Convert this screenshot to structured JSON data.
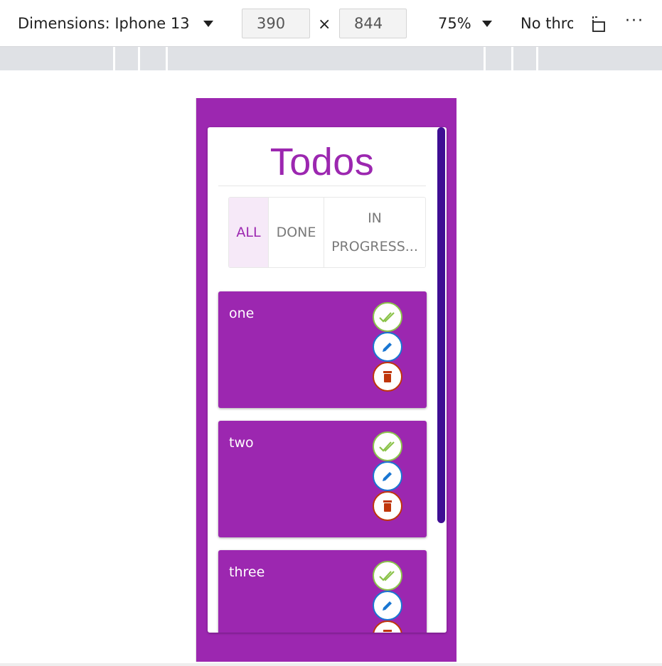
{
  "devtools": {
    "dimensions_label": "Dimensions: Iphone 13",
    "width_value": "390",
    "height_value": "844",
    "times_sign": "×",
    "zoom_label": "75%",
    "throttle_label": "No thro",
    "more_label": "···"
  },
  "app": {
    "title": "Todos",
    "filters": [
      {
        "label": "ALL",
        "active": true
      },
      {
        "label": "DONE",
        "active": false
      },
      {
        "label": "IN PROGRESS...",
        "active": false
      }
    ],
    "todos": [
      {
        "text": "one"
      },
      {
        "text": "two"
      },
      {
        "text": "three"
      }
    ]
  },
  "colors": {
    "primary": "#9c27b0",
    "scrollbar": "#3f0e93",
    "done": "#8bc34a",
    "edit": "#1976d2",
    "delete": "#bf360c"
  }
}
